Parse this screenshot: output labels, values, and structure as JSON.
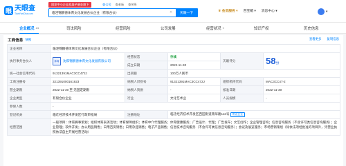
{
  "header": {
    "logo_cn": "天眼查",
    "logo_en": "TianYanCha.com",
    "promo": "国家中小企业发展子基金旗下",
    "cat_links": [
      "查公司",
      "查老板",
      "查关系"
    ],
    "search_value": "临泾锦鹏德体育文化发展合伙企业（有限合伙）",
    "search_button": "天眼一下",
    "links": [
      "会员服务",
      "百宝箱",
      "消息中心"
    ],
    "user_label": "▾"
  },
  "tabs": [
    {
      "label": "企业概况",
      "count": "24"
    },
    {
      "label": "司法风险",
      "count": ""
    },
    {
      "label": "经营风险",
      "count": ""
    },
    {
      "label": "公司发展",
      "count": ""
    },
    {
      "label": "经营状况",
      "count": "5"
    },
    {
      "label": "知识产权",
      "count": ""
    },
    {
      "label": "历史信息",
      "count": ""
    }
  ],
  "section": {
    "title": "工商信息",
    "shot_label": "快照",
    "tools": [
      "查看更多",
      "复制信息"
    ]
  },
  "info": {
    "company_name_label": "企业名称",
    "company_name": "临泾锦鹏德体育文化发展合伙企业（有限合伙）",
    "partner_label": "执行事务合伙人",
    "partner_logo": "体育",
    "partner": "沈阳锦鹏德体育文化发展有限公司",
    "status_label": "经营状态",
    "status": "存续",
    "tianyan_label": "天眼评分",
    "score": "58",
    "score_unit": "分",
    "founded_label": "成立日期",
    "founded": "2022-11-30",
    "credit_code_label": "统一社会信用代码",
    "credit_code": "91321391MAC3CC472J",
    "capital_label": "出资额",
    "capital": "100万人民币",
    "regno_label": "工商注册号",
    "regno": "321391000161923",
    "taxid_label": "纳税人识别号",
    "taxid": "91321391MAC3CC472J",
    "orgcode_label": "组织机构代码",
    "orgcode": "MAC3CC47-2",
    "term_label": "营业期限",
    "term": "2022-11-30 至 无固定期限",
    "taxpayer_label": "纳税人资质",
    "taxpayer": "-",
    "approve_label": "核准日期",
    "approve": "2022-11-30",
    "type_label": "企业类型",
    "type": "有限合伙企业",
    "industry_label": "行业",
    "industry": "文化艺术业",
    "staff_label": "人员规模",
    "staff": "-",
    "insured_label": "参保人数",
    "insured": "-",
    "reg_auth_label": "登记机关",
    "reg_auth": "临迁经济技术开发区行政审批局",
    "address_label": "注册地址",
    "address": "临迁经济技术开发区西园街道南华路112号",
    "nearby": "附近企业",
    "scope_label": "经营范围",
    "scope": "一般项目：体育赛事策划；组织体育表演活动；体育保障组织；体育中介代理服务；体育健康服务；广告设计、代理；广告发布；文艺创作；企业管理咨询；信息咨询服务（不含许可类信息咨询服务）；企业管理；软件开发；办公用品销售；日用百货销售；日用杂品销售；电子产品销售；信息技术咨询服务（不含许可类信息咨询服务）；会议及展览服务；市场营销策划（除依法须经批准的项目外，凭营业执照依法自主开展经营活动）"
  },
  "colors": {
    "accent": "#0084ff",
    "status_green": "#2fa84f",
    "promo_red": "#e63946",
    "vip_gold": "#c88b1e"
  }
}
